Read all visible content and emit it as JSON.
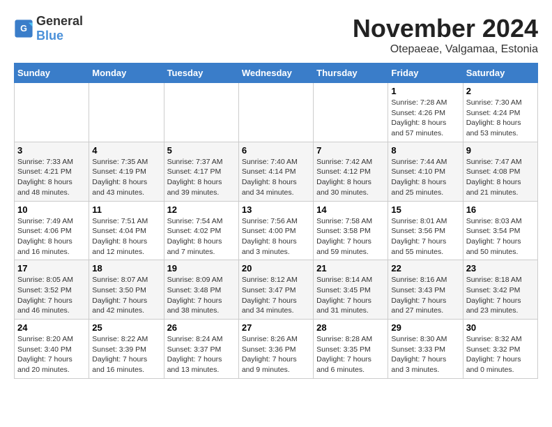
{
  "header": {
    "logo_general": "General",
    "logo_blue": "Blue",
    "month_title": "November 2024",
    "subtitle": "Otepaeae, Valgamaa, Estonia"
  },
  "weekdays": [
    "Sunday",
    "Monday",
    "Tuesday",
    "Wednesday",
    "Thursday",
    "Friday",
    "Saturday"
  ],
  "weeks": [
    [
      {
        "day": "",
        "info": ""
      },
      {
        "day": "",
        "info": ""
      },
      {
        "day": "",
        "info": ""
      },
      {
        "day": "",
        "info": ""
      },
      {
        "day": "",
        "info": ""
      },
      {
        "day": "1",
        "info": "Sunrise: 7:28 AM\nSunset: 4:26 PM\nDaylight: 8 hours\nand 57 minutes."
      },
      {
        "day": "2",
        "info": "Sunrise: 7:30 AM\nSunset: 4:24 PM\nDaylight: 8 hours\nand 53 minutes."
      }
    ],
    [
      {
        "day": "3",
        "info": "Sunrise: 7:33 AM\nSunset: 4:21 PM\nDaylight: 8 hours\nand 48 minutes."
      },
      {
        "day": "4",
        "info": "Sunrise: 7:35 AM\nSunset: 4:19 PM\nDaylight: 8 hours\nand 43 minutes."
      },
      {
        "day": "5",
        "info": "Sunrise: 7:37 AM\nSunset: 4:17 PM\nDaylight: 8 hours\nand 39 minutes."
      },
      {
        "day": "6",
        "info": "Sunrise: 7:40 AM\nSunset: 4:14 PM\nDaylight: 8 hours\nand 34 minutes."
      },
      {
        "day": "7",
        "info": "Sunrise: 7:42 AM\nSunset: 4:12 PM\nDaylight: 8 hours\nand 30 minutes."
      },
      {
        "day": "8",
        "info": "Sunrise: 7:44 AM\nSunset: 4:10 PM\nDaylight: 8 hours\nand 25 minutes."
      },
      {
        "day": "9",
        "info": "Sunrise: 7:47 AM\nSunset: 4:08 PM\nDaylight: 8 hours\nand 21 minutes."
      }
    ],
    [
      {
        "day": "10",
        "info": "Sunrise: 7:49 AM\nSunset: 4:06 PM\nDaylight: 8 hours\nand 16 minutes."
      },
      {
        "day": "11",
        "info": "Sunrise: 7:51 AM\nSunset: 4:04 PM\nDaylight: 8 hours\nand 12 minutes."
      },
      {
        "day": "12",
        "info": "Sunrise: 7:54 AM\nSunset: 4:02 PM\nDaylight: 8 hours\nand 7 minutes."
      },
      {
        "day": "13",
        "info": "Sunrise: 7:56 AM\nSunset: 4:00 PM\nDaylight: 8 hours\nand 3 minutes."
      },
      {
        "day": "14",
        "info": "Sunrise: 7:58 AM\nSunset: 3:58 PM\nDaylight: 7 hours\nand 59 minutes."
      },
      {
        "day": "15",
        "info": "Sunrise: 8:01 AM\nSunset: 3:56 PM\nDaylight: 7 hours\nand 55 minutes."
      },
      {
        "day": "16",
        "info": "Sunrise: 8:03 AM\nSunset: 3:54 PM\nDaylight: 7 hours\nand 50 minutes."
      }
    ],
    [
      {
        "day": "17",
        "info": "Sunrise: 8:05 AM\nSunset: 3:52 PM\nDaylight: 7 hours\nand 46 minutes."
      },
      {
        "day": "18",
        "info": "Sunrise: 8:07 AM\nSunset: 3:50 PM\nDaylight: 7 hours\nand 42 minutes."
      },
      {
        "day": "19",
        "info": "Sunrise: 8:09 AM\nSunset: 3:48 PM\nDaylight: 7 hours\nand 38 minutes."
      },
      {
        "day": "20",
        "info": "Sunrise: 8:12 AM\nSunset: 3:47 PM\nDaylight: 7 hours\nand 34 minutes."
      },
      {
        "day": "21",
        "info": "Sunrise: 8:14 AM\nSunset: 3:45 PM\nDaylight: 7 hours\nand 31 minutes."
      },
      {
        "day": "22",
        "info": "Sunrise: 8:16 AM\nSunset: 3:43 PM\nDaylight: 7 hours\nand 27 minutes."
      },
      {
        "day": "23",
        "info": "Sunrise: 8:18 AM\nSunset: 3:42 PM\nDaylight: 7 hours\nand 23 minutes."
      }
    ],
    [
      {
        "day": "24",
        "info": "Sunrise: 8:20 AM\nSunset: 3:40 PM\nDaylight: 7 hours\nand 20 minutes."
      },
      {
        "day": "25",
        "info": "Sunrise: 8:22 AM\nSunset: 3:39 PM\nDaylight: 7 hours\nand 16 minutes."
      },
      {
        "day": "26",
        "info": "Sunrise: 8:24 AM\nSunset: 3:37 PM\nDaylight: 7 hours\nand 13 minutes."
      },
      {
        "day": "27",
        "info": "Sunrise: 8:26 AM\nSunset: 3:36 PM\nDaylight: 7 hours\nand 9 minutes."
      },
      {
        "day": "28",
        "info": "Sunrise: 8:28 AM\nSunset: 3:35 PM\nDaylight: 7 hours\nand 6 minutes."
      },
      {
        "day": "29",
        "info": "Sunrise: 8:30 AM\nSunset: 3:33 PM\nDaylight: 7 hours\nand 3 minutes."
      },
      {
        "day": "30",
        "info": "Sunrise: 8:32 AM\nSunset: 3:32 PM\nDaylight: 7 hours\nand 0 minutes."
      }
    ]
  ]
}
